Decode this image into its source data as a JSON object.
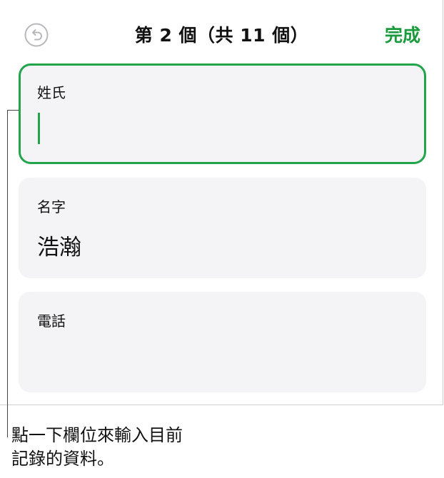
{
  "header": {
    "title": "第 2 個（共 11 個）",
    "done_label": "完成",
    "back_icon": "undo-arrow-icon"
  },
  "fields": [
    {
      "label": "姓氏",
      "value": "",
      "focused": true
    },
    {
      "label": "名字",
      "value": "浩瀚",
      "focused": false
    },
    {
      "label": "電話",
      "value": "",
      "focused": false
    }
  ],
  "callout": {
    "line1": "點一下欄位來輸入目前",
    "line2": "記錄的資料。"
  },
  "colors": {
    "accent": "#1a9a3c",
    "field_bg": "#f4f4f6",
    "icon_gray": "#b8b8bc"
  }
}
